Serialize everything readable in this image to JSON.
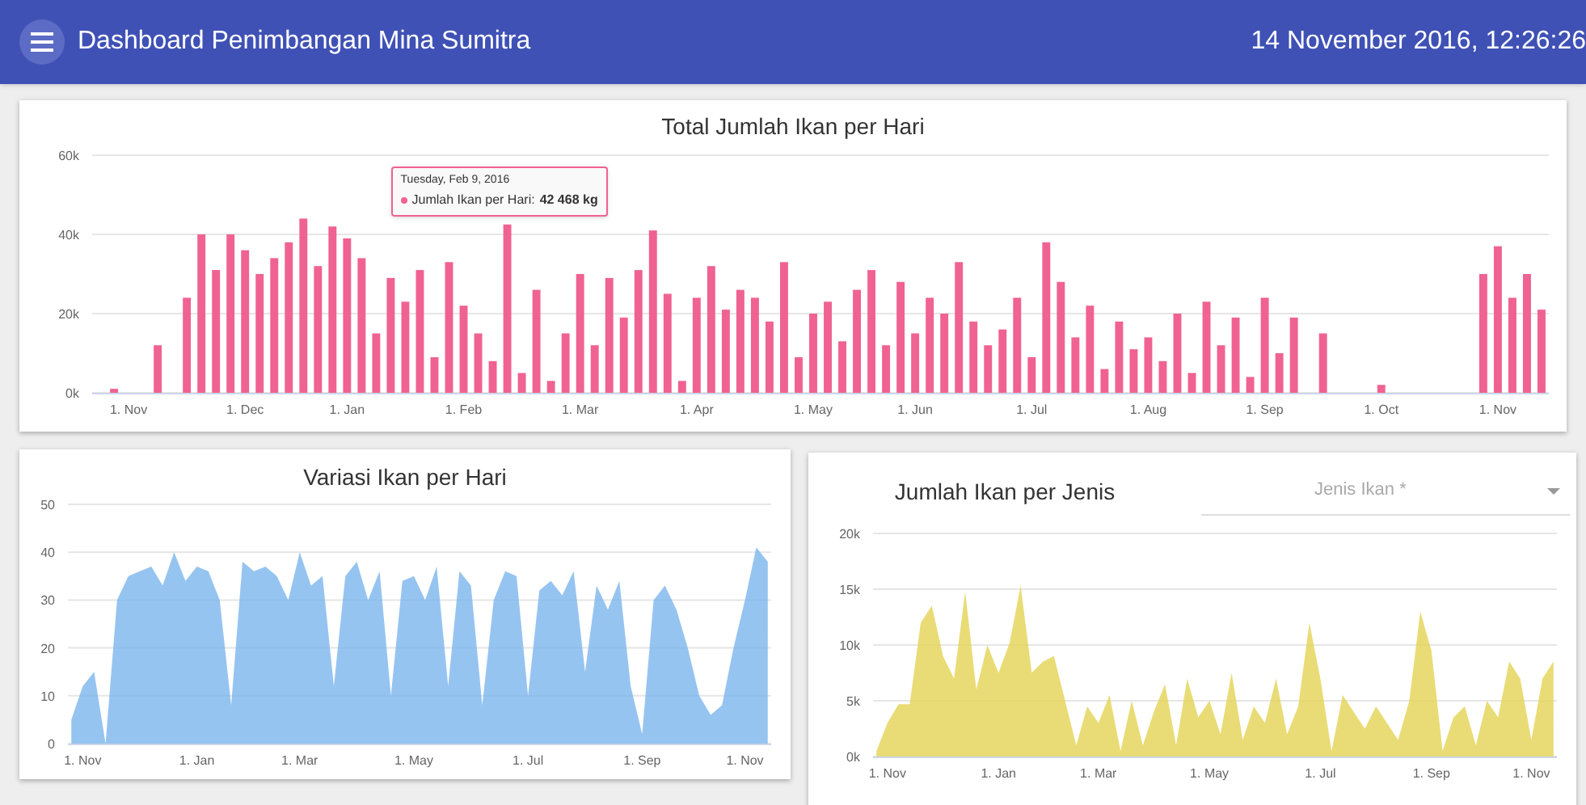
{
  "app_bar": {
    "title": "Dashboard Penimbangan Mina Sumitra",
    "datetime": "14 November 2016, 12:26:26"
  },
  "daily_total": {
    "title": "Total Jumlah Ikan per Hari",
    "tooltip": {
      "date": "Tuesday, Feb 9, 2016",
      "series": "Jumlah Ikan per Hari:",
      "value": "42 468 kg"
    },
    "chart_data": {
      "type": "bar",
      "grid": true,
      "ylim": [
        0,
        60000
      ],
      "yticks": [
        {
          "value": 0,
          "label": "0k"
        },
        {
          "value": 20000,
          "label": "20k"
        },
        {
          "value": 40000,
          "label": "40k"
        },
        {
          "value": 60000,
          "label": "60k"
        }
      ],
      "categories": [
        null,
        null,
        "1. Nov",
        null,
        null,
        null,
        null,
        null,
        null,
        null,
        "1. Dec",
        null,
        null,
        null,
        null,
        null,
        null,
        "1. Jan",
        null,
        null,
        null,
        null,
        null,
        null,
        null,
        "1. Feb",
        null,
        null,
        null,
        null,
        null,
        null,
        null,
        "1. Mar",
        null,
        null,
        null,
        null,
        null,
        null,
        null,
        "1. Apr",
        null,
        null,
        null,
        null,
        null,
        null,
        null,
        "1. May",
        null,
        null,
        null,
        null,
        null,
        null,
        "1. Jun",
        null,
        null,
        null,
        null,
        null,
        null,
        null,
        "1. Jul",
        null,
        null,
        null,
        null,
        null,
        null,
        null,
        "1. Aug",
        null,
        null,
        null,
        null,
        null,
        null,
        null,
        "1. Sep",
        null,
        null,
        null,
        null,
        null,
        null,
        null,
        "1. Oct",
        null,
        null,
        null,
        null,
        null,
        null,
        null,
        "1. Nov",
        null,
        null,
        null
      ],
      "series": [
        {
          "color": "#f06292",
          "values": [
            0,
            1000,
            0,
            0,
            12000,
            0,
            24000,
            40000,
            31000,
            40000,
            36000,
            30000,
            34000,
            38000,
            44000,
            32000,
            42000,
            39000,
            34000,
            15000,
            29000,
            23000,
            31000,
            9000,
            33000,
            22000,
            15000,
            8000,
            42500,
            5000,
            26000,
            3000,
            15000,
            30000,
            12000,
            29000,
            19000,
            31000,
            41000,
            25000,
            3000,
            24000,
            32000,
            21000,
            26000,
            24000,
            18000,
            33000,
            9000,
            20000,
            23000,
            13000,
            26000,
            31000,
            12000,
            28000,
            15000,
            24000,
            20000,
            33000,
            18000,
            12000,
            16000,
            24000,
            9000,
            38000,
            28000,
            14000,
            22000,
            6000,
            18000,
            11000,
            14000,
            8000,
            20000,
            5000,
            23000,
            12000,
            19000,
            4000,
            24000,
            10000,
            19000,
            0,
            15000,
            0,
            0,
            0,
            2000,
            0,
            0,
            0,
            0,
            0,
            0,
            30000,
            37000,
            24000,
            30000,
            21000
          ]
        }
      ]
    }
  },
  "variation": {
    "title": "Variasi Ikan per Hari",
    "chart_data": {
      "type": "area",
      "grid": true,
      "ylim": [
        0,
        50
      ],
      "yticks": [
        0,
        10,
        20,
        30,
        40,
        50
      ],
      "categories": [
        null,
        "1. Nov",
        null,
        null,
        null,
        null,
        null,
        null,
        null,
        null,
        null,
        "1. Jan",
        null,
        null,
        null,
        null,
        null,
        null,
        null,
        null,
        "1. Mar",
        null,
        null,
        null,
        null,
        null,
        null,
        null,
        null,
        null,
        "1. May",
        null,
        null,
        null,
        null,
        null,
        null,
        null,
        null,
        null,
        "1. Jul",
        null,
        null,
        null,
        null,
        null,
        null,
        null,
        null,
        null,
        "1. Sep",
        null,
        null,
        null,
        null,
        null,
        null,
        null,
        null,
        "1. Nov",
        null,
        null
      ],
      "series": [
        {
          "color": "#7cb5ec",
          "values": [
            5,
            12,
            15,
            0,
            30,
            35,
            36,
            37,
            33,
            40,
            34,
            37,
            36,
            30,
            8,
            38,
            36,
            37,
            35,
            30,
            40,
            33,
            35,
            12,
            35,
            38,
            30,
            36,
            10,
            34,
            35,
            30,
            37,
            12,
            36,
            33,
            8,
            30,
            36,
            35,
            10,
            32,
            34,
            31,
            36,
            15,
            33,
            28,
            34,
            12,
            2,
            30,
            33,
            28,
            20,
            10,
            6,
            8,
            20,
            30,
            41,
            38
          ]
        }
      ]
    }
  },
  "per_type": {
    "title": "Jumlah Ikan per Jenis",
    "select": {
      "placeholder": "Jenis Ikan *"
    },
    "chart_data": {
      "type": "area",
      "grid": true,
      "ylim": [
        0,
        20000
      ],
      "yticks": [
        {
          "value": 0,
          "label": "0k"
        },
        {
          "value": 5000,
          "label": "5k"
        },
        {
          "value": 10000,
          "label": "10k"
        },
        {
          "value": 15000,
          "label": "15k"
        },
        {
          "value": 20000,
          "label": "20k"
        }
      ],
      "categories": [
        null,
        "1. Nov",
        null,
        null,
        null,
        null,
        null,
        null,
        null,
        null,
        null,
        "1. Jan",
        null,
        null,
        null,
        null,
        null,
        null,
        null,
        null,
        "1. Mar",
        null,
        null,
        null,
        null,
        null,
        null,
        null,
        null,
        null,
        "1. May",
        null,
        null,
        null,
        null,
        null,
        null,
        null,
        null,
        null,
        "1. Jul",
        null,
        null,
        null,
        null,
        null,
        null,
        null,
        null,
        null,
        "1. Sep",
        null,
        null,
        null,
        null,
        null,
        null,
        null,
        null,
        "1. Nov",
        null,
        null
      ],
      "series": [
        {
          "color": "#e4d354",
          "values": [
            500,
            3000,
            4700,
            4700,
            12000,
            13500,
            9000,
            7000,
            14800,
            6000,
            10000,
            7500,
            10200,
            15300,
            7500,
            8500,
            9000,
            5000,
            1000,
            4500,
            3000,
            5500,
            500,
            5000,
            1000,
            4000,
            6500,
            1000,
            7000,
            3500,
            5000,
            2000,
            7500,
            1500,
            4500,
            3000,
            7000,
            2000,
            4500,
            12000,
            7000,
            500,
            5500,
            4000,
            2500,
            4500,
            3000,
            1500,
            5000,
            13000,
            9500,
            500,
            3500,
            4500,
            1000,
            5000,
            3500,
            8500,
            7000,
            1500,
            7000,
            8500
          ]
        }
      ]
    }
  }
}
